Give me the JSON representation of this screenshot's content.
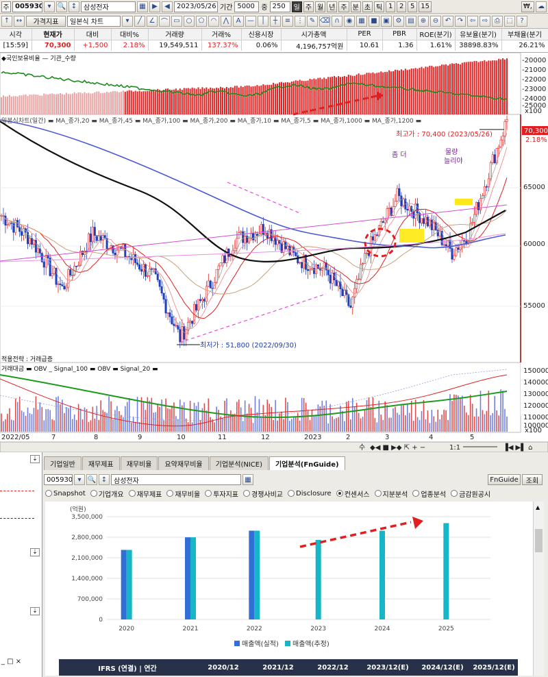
{
  "toolbar1": {
    "market_prefix": "주",
    "stock_code": "005930",
    "stock_name": "삼성전자",
    "date": "2023/05/26",
    "period_label": "기간",
    "period_value": "5000",
    "count_label": "중",
    "count_value": "250",
    "interval_buttons": [
      "일",
      "주",
      "월",
      "년",
      "주",
      "분",
      "초",
      "틱",
      "1",
      "2",
      "5",
      "15"
    ],
    "unit_label": "₩,"
  },
  "toolbar2": {
    "price_indicator_label": "가격지표",
    "chart_type": "일본식 차트"
  },
  "price_table": {
    "headers": [
      "시각",
      "현재가",
      "대비",
      "대비%",
      "거래량",
      "거래%",
      "신용시장",
      "시가총액",
      "PER",
      "PBR",
      "ROE(분기)",
      "유보율(분기)",
      "부채율(분기"
    ],
    "values": [
      "[15:59]",
      "70,300",
      "+1,500",
      "2.18%",
      "19,549,511",
      "137.37%",
      "0.06%",
      "4,196,757억원",
      "10.61",
      "1.36",
      "1.61%",
      "38898.83%",
      "26.21%"
    ]
  },
  "chart": {
    "pane1_legend": "◆국인보유비율 — 기관_수량",
    "pane1_axis": [
      "-20000",
      "-21000",
      "-22000",
      "-23000",
      "-24000",
      "-25000",
      "x100"
    ],
    "pane2_legend": "일본식차트(일간) ▬ MA_종가,20 ▬ MA_종가,45 ▬ MA_종가,100 ▬ MA_종가,200 ▬ MA_종가,10 ▬ MA_종가,5 ▬ MA_종가,1000 ▬ MA_종가,1200 ▬",
    "price_axis": [
      "65000",
      "60000",
      "55000"
    ],
    "last_price": "70,300",
    "last_change": "2.18%",
    "high_label": "최고가 : 70,400 (2023/05/26)",
    "low_label": "최저가 : 51,800 (2022/09/30)",
    "ann_more": "좀 더",
    "ann_volume": "물량",
    "ann_volume2": "늘리야",
    "strategy_label": "적용전략 : 거래급증",
    "pane3_legend": "거래대금 ▬ OBV _ Signal_100 ▬ OBV ▬ Signal_20 ▬",
    "pane3_axis": [
      "150000",
      "140000",
      "130000",
      "120000",
      "110000",
      "100000",
      "x100"
    ],
    "time_axis": [
      "2022/05",
      "7",
      "8",
      "9",
      "10",
      "11",
      "12",
      "2023",
      "2",
      "3",
      "4",
      "5"
    ],
    "zoom_label": "1:1",
    "nav_label": "수"
  },
  "bottom": {
    "tabs": [
      "기업일반",
      "재무제표",
      "재무비율",
      "요약재무비율",
      "기업분석(NICE)",
      "기업분석(FnGuide)"
    ],
    "stock_code": "005930",
    "stock_name": "삼성전자",
    "fnguide_button": "FnGuide",
    "query_button": "조회",
    "radios": [
      "Snapshot",
      "기업개요",
      "재무제표",
      "재무비율",
      "투자지표",
      "경쟁사비교",
      "Disclosure",
      "컨센서스",
      "지분분석",
      "업종분석",
      "금감원공시"
    ],
    "selected_radio": "컨센서스",
    "table_header": [
      "IFRS (연결) | 연간",
      "2020/12",
      "2021/12",
      "2022/12",
      "2023/12(E)",
      "2024/12(E)",
      "2025/12(E)"
    ]
  },
  "chart_data": {
    "type": "bar",
    "categories": [
      "2020",
      "2021",
      "2022",
      "2023",
      "2024",
      "2025"
    ],
    "ylabel": "(억원)",
    "ylim": [
      0,
      3500000
    ],
    "yticks": [
      "3,500,000",
      "2,800,000",
      "2,100,000",
      "1,400,000",
      "700,000",
      "0"
    ],
    "series": [
      {
        "name": "매출액(실적)",
        "color": "#2f6fd6",
        "values": [
          2368070,
          2796048,
          3022314,
          null,
          null,
          null
        ]
      },
      {
        "name": "매출액(추정)",
        "color": "#17b5c8",
        "values": [
          2368070,
          2796048,
          3022314,
          2710000,
          3020000,
          3280000
        ]
      }
    ]
  }
}
